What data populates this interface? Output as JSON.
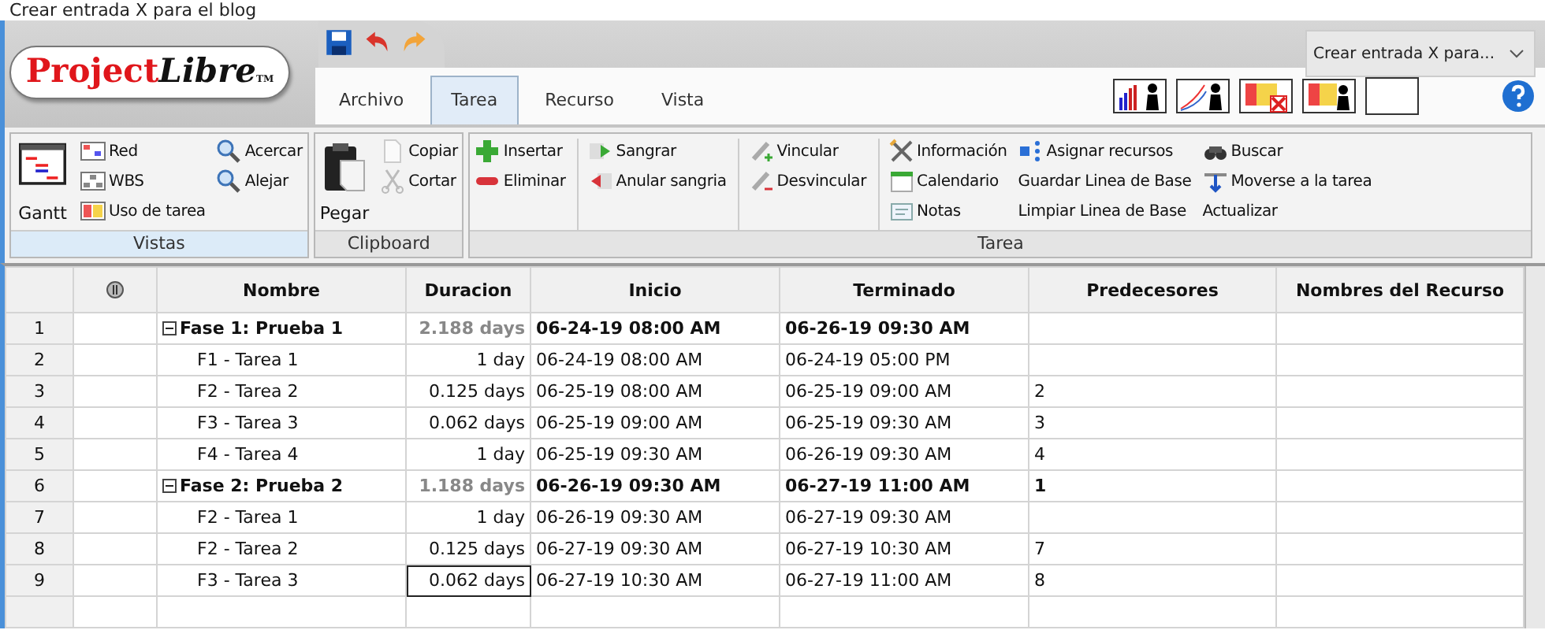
{
  "window": {
    "title": "Crear entrada X para el blog"
  },
  "logo": {
    "first": "Project",
    "second": "Libre",
    "mark": "TM"
  },
  "project_selector": {
    "value": "Crear entrada X para..."
  },
  "tabs": [
    {
      "label": "Archivo",
      "selected": false
    },
    {
      "label": "Tarea",
      "selected": true
    },
    {
      "label": "Recurso",
      "selected": false
    },
    {
      "label": "Vista",
      "selected": false
    }
  ],
  "ribbon_groups": [
    {
      "label": "Vistas",
      "selected": true,
      "columns": [
        [
          {
            "label": "Gantt",
            "kind": "large"
          }
        ],
        [
          {
            "label": "Red",
            "kind": "small"
          },
          {
            "label": "WBS",
            "kind": "small"
          },
          {
            "label": "Uso de tarea",
            "kind": "small"
          }
        ],
        [
          {
            "label": "Acercar",
            "kind": "small"
          },
          {
            "label": "Alejar",
            "kind": "small"
          }
        ]
      ]
    },
    {
      "label": "Clipboard",
      "selected": false,
      "columns": [
        [
          {
            "label": "Pegar",
            "kind": "large"
          }
        ],
        [
          {
            "label": "Copiar",
            "kind": "small"
          },
          {
            "label": "Cortar",
            "kind": "small"
          }
        ]
      ]
    },
    {
      "label": "Tarea",
      "selected": false,
      "columns": [
        [
          {
            "label": "Insertar",
            "kind": "small"
          },
          {
            "label": "Eliminar",
            "kind": "small"
          }
        ],
        [
          {
            "label": "Sangrar",
            "kind": "small"
          },
          {
            "label": "Anular sangria",
            "kind": "small"
          }
        ],
        [
          {
            "label": "Vincular",
            "kind": "small"
          },
          {
            "label": "Desvincular",
            "kind": "small"
          }
        ],
        [
          {
            "label": "Información",
            "kind": "small"
          },
          {
            "label": "Calendario",
            "kind": "small"
          },
          {
            "label": "Notas",
            "kind": "small"
          }
        ],
        [
          {
            "label": "Asignar recursos",
            "kind": "small"
          },
          {
            "label": "Guardar Linea de Base",
            "kind": "text"
          },
          {
            "label": "Limpiar Linea de Base",
            "kind": "text"
          }
        ],
        [
          {
            "label": "Buscar",
            "kind": "small"
          },
          {
            "label": "Moverse a la tarea",
            "kind": "small"
          },
          {
            "label": "Actualizar",
            "kind": "text"
          }
        ]
      ]
    }
  ],
  "table": {
    "columns": [
      "Nombre",
      "Duracion",
      "Inicio",
      "Terminado",
      "Predecesores",
      "Nombres del Recurso"
    ],
    "rows": [
      {
        "id": "1",
        "name": "Fase 1: Prueba 1",
        "duration": "2.188 days",
        "start": "06-24-19 08:00 AM",
        "finish": "06-26-19 09:30 AM",
        "selected": false,
        "expanded": true,
        "children": [
          {
            "id": "2",
            "name": "F1 - Tarea 1",
            "duration": "1 day",
            "start": "06-24-19 08:00 AM",
            "finish": "06-24-19 05:00 PM",
            "selected": false
          },
          {
            "id": "3",
            "name": "F2 - Tarea 2",
            "duration": "0.125 days",
            "start": "06-25-19 08:00 AM",
            "finish": "06-25-19 09:00 AM",
            "predecessors": "2",
            "selected": false
          },
          {
            "id": "4",
            "name": "F3 - Tarea 3",
            "duration": "0.062 days",
            "start": "06-25-19 09:00 AM",
            "finish": "06-25-19 09:30 AM",
            "predecessors": "3",
            "selected": false
          },
          {
            "id": "5",
            "name": "F4 - Tarea 4",
            "duration": "1 day",
            "start": "06-25-19 09:30 AM",
            "finish": "06-26-19 09:30 AM",
            "predecessors": "4",
            "selected": false
          }
        ]
      },
      {
        "id": "6",
        "name": "Fase 2: Prueba 2",
        "duration": "1.188 days",
        "start": "06-26-19 09:30 AM",
        "finish": "06-27-19 11:00 AM",
        "predecessors": "1",
        "selected": false,
        "expanded": true,
        "children": [
          {
            "id": "7",
            "name": "F2 - Tarea 1",
            "duration": "1 day",
            "start": "06-26-19 09:30 AM",
            "finish": "06-27-19 09:30 AM",
            "selected": false
          },
          {
            "id": "8",
            "name": "F2 - Tarea 2",
            "duration": "0.125 days",
            "start": "06-27-19 09:30 AM",
            "finish": "06-27-19 10:30 AM",
            "predecessors": "7",
            "selected": false
          },
          {
            "id": "9",
            "name": "F3 - Tarea 3",
            "duration": "0.062 days",
            "start": "06-27-19 10:30 AM",
            "finish": "06-27-19 11:00 AM",
            "predecessors": "8",
            "selected": true
          }
        ]
      }
    ]
  }
}
